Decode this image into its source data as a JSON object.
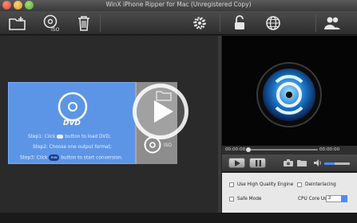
{
  "window": {
    "title": "WinX iPhone Ripper for Mac (Unregistered Copy)"
  },
  "toolbar": {
    "buttons": [
      {
        "icon": "add-folder-icon",
        "tooltip": ""
      },
      {
        "icon": "iso-disc-icon",
        "label": "ISO"
      },
      {
        "icon": "trash-icon"
      },
      {
        "icon": "gear-icon"
      },
      {
        "icon": "unlock-icon"
      },
      {
        "icon": "globe-icon"
      },
      {
        "icon": "users-icon"
      }
    ]
  },
  "hint": {
    "dvd_label": "DVD",
    "step1_prefix": "Step1: Click",
    "step1_suffix": "button to load DVD;",
    "step2": "Step2: Choose one output format;",
    "step3_prefix": "Step3: Click",
    "step3_suffix": "button to start conversion.",
    "run_label": "RUN",
    "iso_label": "ISO"
  },
  "player": {
    "time_current": "00:00:00",
    "time_total": "00:00:00",
    "volume_level": 0.4
  },
  "options": {
    "high_quality": "Use High Quality Engine",
    "deinterlacing": "Deinterlacing",
    "safe_mode": "Safe Mode",
    "cpu_core_label": "CPU Core Use",
    "cpu_core_value": "2"
  },
  "colors": {
    "hint_panel": "#5d95e6",
    "accent_blue": "#4a8cff",
    "toolbar": "#3c3c3c"
  }
}
